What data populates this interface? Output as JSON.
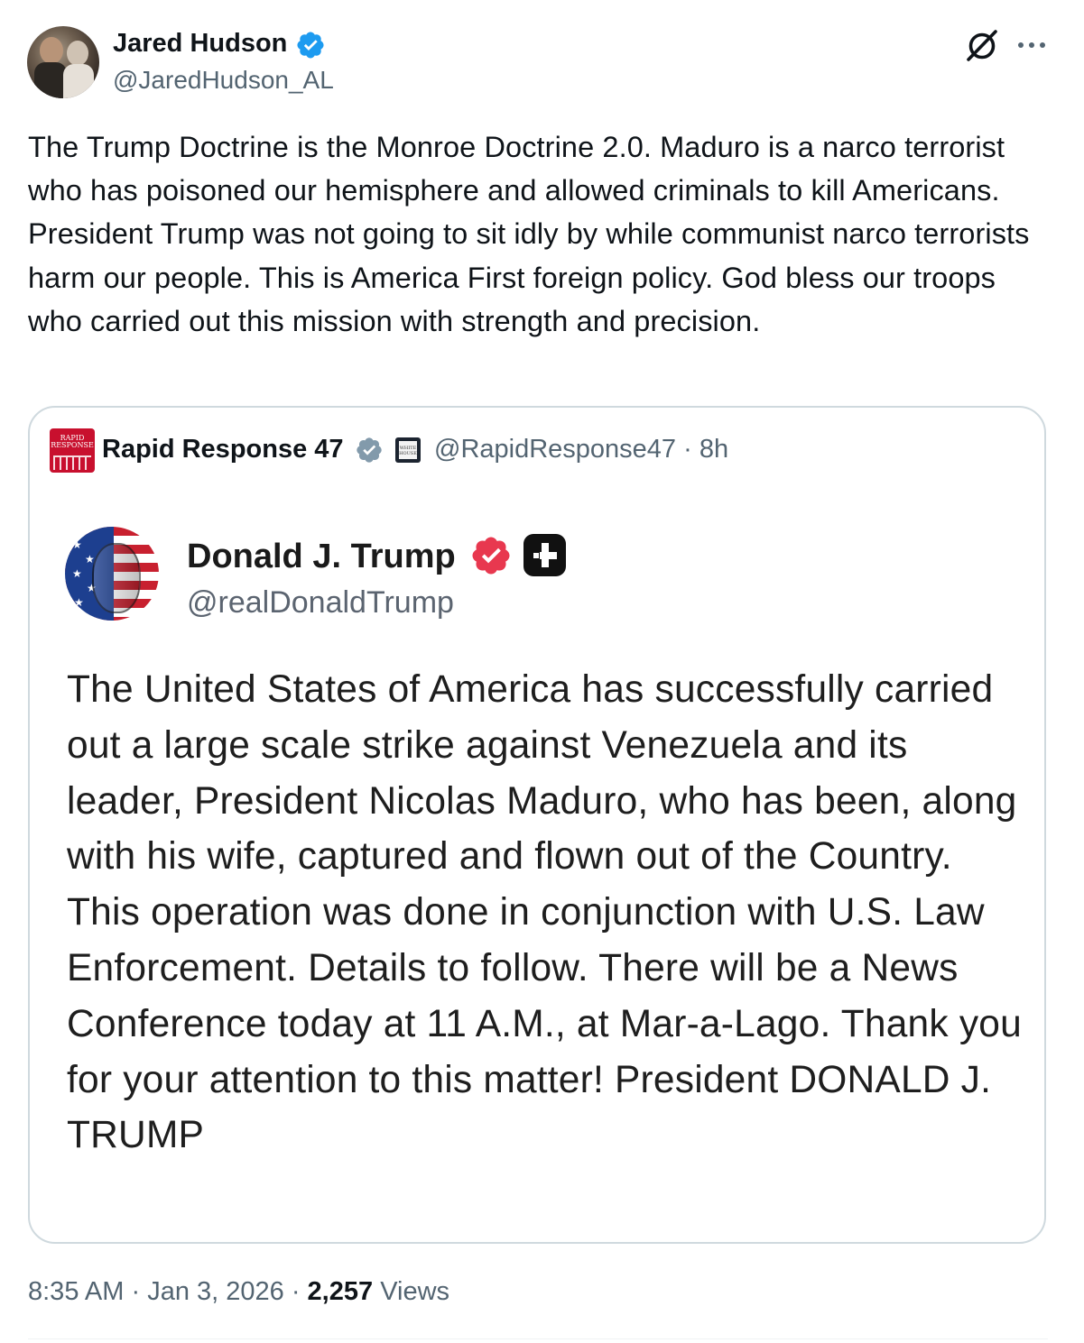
{
  "tweet": {
    "author_name": "Jared Hudson",
    "author_handle": "@JaredHudson_AL",
    "text": "The Trump Doctrine is the Monroe Doctrine 2.0. Maduro is a narco terrorist who has poisoned our hemisphere and allowed criminals to kill Americans. President Trump was not going to sit idly by while communist narco terrorists harm our people. This is America First foreign policy. God bless our troops who carried out this mission with strength and precision.",
    "time": "8:35 AM",
    "date": "Jan 3, 2026",
    "views_count": "2,257",
    "views_label": "Views",
    "icons": {
      "verified": "verified-badge-icon",
      "grok": "grok-icon",
      "more": "more-icon"
    }
  },
  "quote": {
    "author_name": "Rapid Response 47",
    "author_handle": "@RapidResponse47",
    "age": "8h",
    "avatar_text_1": "RAPID",
    "avatar_text_2": "RESPONSE",
    "badge_text_1": "WHITE",
    "badge_text_2": "HOUSE",
    "embedded_post": {
      "author_name": "Donald J. Trump",
      "author_handle": "@realDonaldTrump",
      "text": "The United States of America has successfully carried out a large scale strike against Venezuela and its leader, President Nicolas Maduro, who has been, along with his wife, captured and flown out of the Country. This operation was done in conjunction with U.S. Law Enforcement. Details to follow. There will be a News Conference today at 11 A.M., at Mar-a-Lago. Thank you for your attention to this matter! President DONALD J. TRUMP"
    }
  },
  "colors": {
    "verified_blue": "#1d9bf0",
    "verified_gray": "#829aab",
    "truth_verified_pink": "#e8384f",
    "secondary_text": "#536471",
    "card_border": "#cfd9de"
  }
}
